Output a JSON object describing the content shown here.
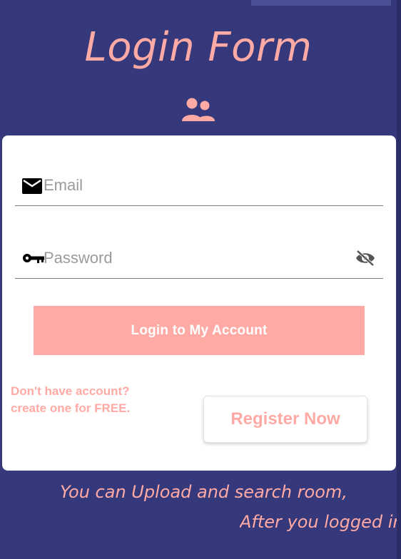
{
  "header": {
    "title": "Login Form",
    "icon": "people-icon"
  },
  "form": {
    "email": {
      "icon": "mail-icon",
      "placeholder": "Email",
      "value": ""
    },
    "password": {
      "icon": "key-icon",
      "placeholder": "Password",
      "value": "",
      "toggle_icon": "eye-off-icon"
    },
    "login_label": "Login to My Account",
    "hint_line1": "Don't have account?",
    "hint_line2": "create one for FREE.",
    "register_label": "Register Now"
  },
  "footer": {
    "line1": "You can Upload and search room,",
    "line2": "After you logged in"
  },
  "colors": {
    "background": "#35387a",
    "accent": "#ffaaa5",
    "card": "#ffffff"
  }
}
